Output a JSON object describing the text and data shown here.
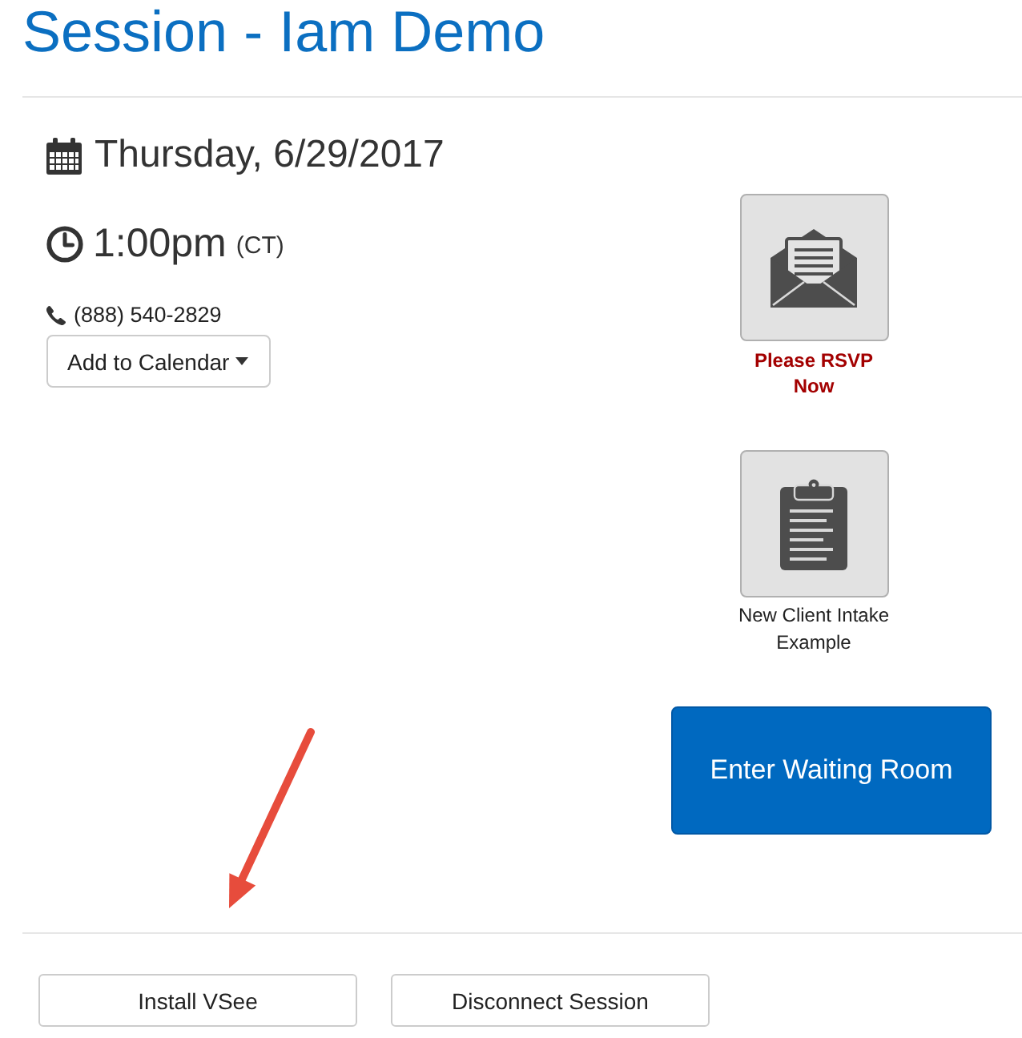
{
  "title": "Session - Iam Demo",
  "schedule": {
    "date": "Thursday, 6/29/2017",
    "time": "1:00pm",
    "timezone": "(CT)",
    "phone": "(888) 540-2829"
  },
  "calendar_button": {
    "label": "Add to Calendar"
  },
  "actions": [
    {
      "kind": "rsvp",
      "label": "Please RSVP Now"
    },
    {
      "kind": "form",
      "label": "New Client Intake Example"
    }
  ],
  "primary_button": {
    "label": "Enter Waiting Room"
  },
  "annotations": [
    {
      "kind": "arrow"
    }
  ],
  "footer_buttons": [
    "Install VSee",
    "Disconnect Session"
  ]
}
